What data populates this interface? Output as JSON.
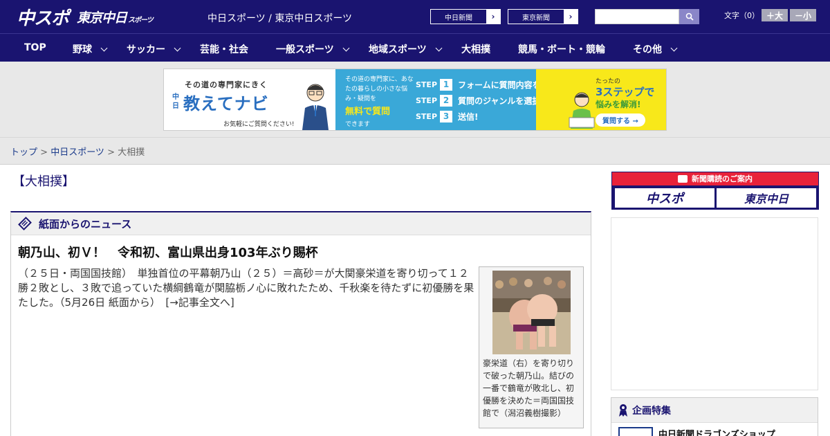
{
  "header": {
    "logo_chuspo": "中スポ",
    "logo_tokyo": "東京中日",
    "logo_tokyo_suffix": "スポーツ",
    "site_name": "中日スポーツ / 東京中日スポーツ",
    "btn_chunichi": "中日新聞",
    "btn_tokyo": "東京新聞",
    "search_placeholder": "",
    "font_label": "文字（0）",
    "font_up": "＋大",
    "font_down": "－小"
  },
  "nav": {
    "items": [
      {
        "label": "TOP",
        "dropdown": false
      },
      {
        "label": "野球",
        "dropdown": true
      },
      {
        "label": "サッカー",
        "dropdown": true
      },
      {
        "label": "芸能・社会",
        "dropdown": false
      },
      {
        "label": "一般スポーツ",
        "dropdown": true
      },
      {
        "label": "地域スポーツ",
        "dropdown": true
      },
      {
        "label": "大相撲",
        "dropdown": false
      },
      {
        "label": "競馬・ボート・競輪",
        "dropdown": false
      },
      {
        "label": "その他",
        "dropdown": true
      }
    ]
  },
  "banner": {
    "top": "その道の専門家にきく",
    "chu": "中日",
    "title": "教えてナビ",
    "small": "お気軽にご質問ください!",
    "mid_text": "その道の専門家に、あなたの暮らしの小さな悩み・疑問を",
    "mid_free": "無料で質問",
    "mid_dekimasu": "できます",
    "steps": [
      {
        "step": "STEP",
        "num": "1",
        "text": "フォームに質問内容を入力"
      },
      {
        "step": "STEP",
        "num": "2",
        "text": "質問のジャンルを選択"
      },
      {
        "step": "STEP",
        "num": "3",
        "text": "送信!"
      }
    ],
    "right_small": "たったの",
    "right_big": "3ステップで",
    "right_big2": "悩みを解消!",
    "right_btn": "質問する →"
  },
  "breadcrumb": {
    "top": "トップ",
    "sep": " > ",
    "section": "中日スポーツ",
    "current": "大相撲"
  },
  "main": {
    "category_title": "【大相撲】",
    "news_heading": "紙面からのニュース",
    "headline": "朝乃山、初Ｖ！　令和初、富山県出身103年ぶり賜杯",
    "body": "（２５日・両国国技館）　単独首位の平幕朝乃山（２５）＝高砂＝が大関豪栄道を寄り切って１２勝２敗とし、３敗で追っていた横綱鶴竜が関脇栃ノ心に敗れたため、千秋楽を待たずに初優勝を果たした。（5月26日 紙面から）　",
    "more": "[→記事全文へ]",
    "caption": "豪栄道（右）を寄り切りで破った朝乃山。結びの一番で鶴竜が敗北し、初優勝を決めた＝両国国技館で（潟沼義樹撮影）"
  },
  "sidebar": {
    "subscribe_title": "新聞購読のご案内",
    "subscribe_chuspo": "中スポ",
    "subscribe_tokyo": "東京中日",
    "feature_title": "企画特集",
    "feature_item": "中日新聞ドラゴンズショップ"
  },
  "colors": {
    "navy": "#1a1470",
    "red": "#e8223a",
    "banner_blue": "#3aa8d8",
    "banner_yellow": "#f8e81a"
  }
}
